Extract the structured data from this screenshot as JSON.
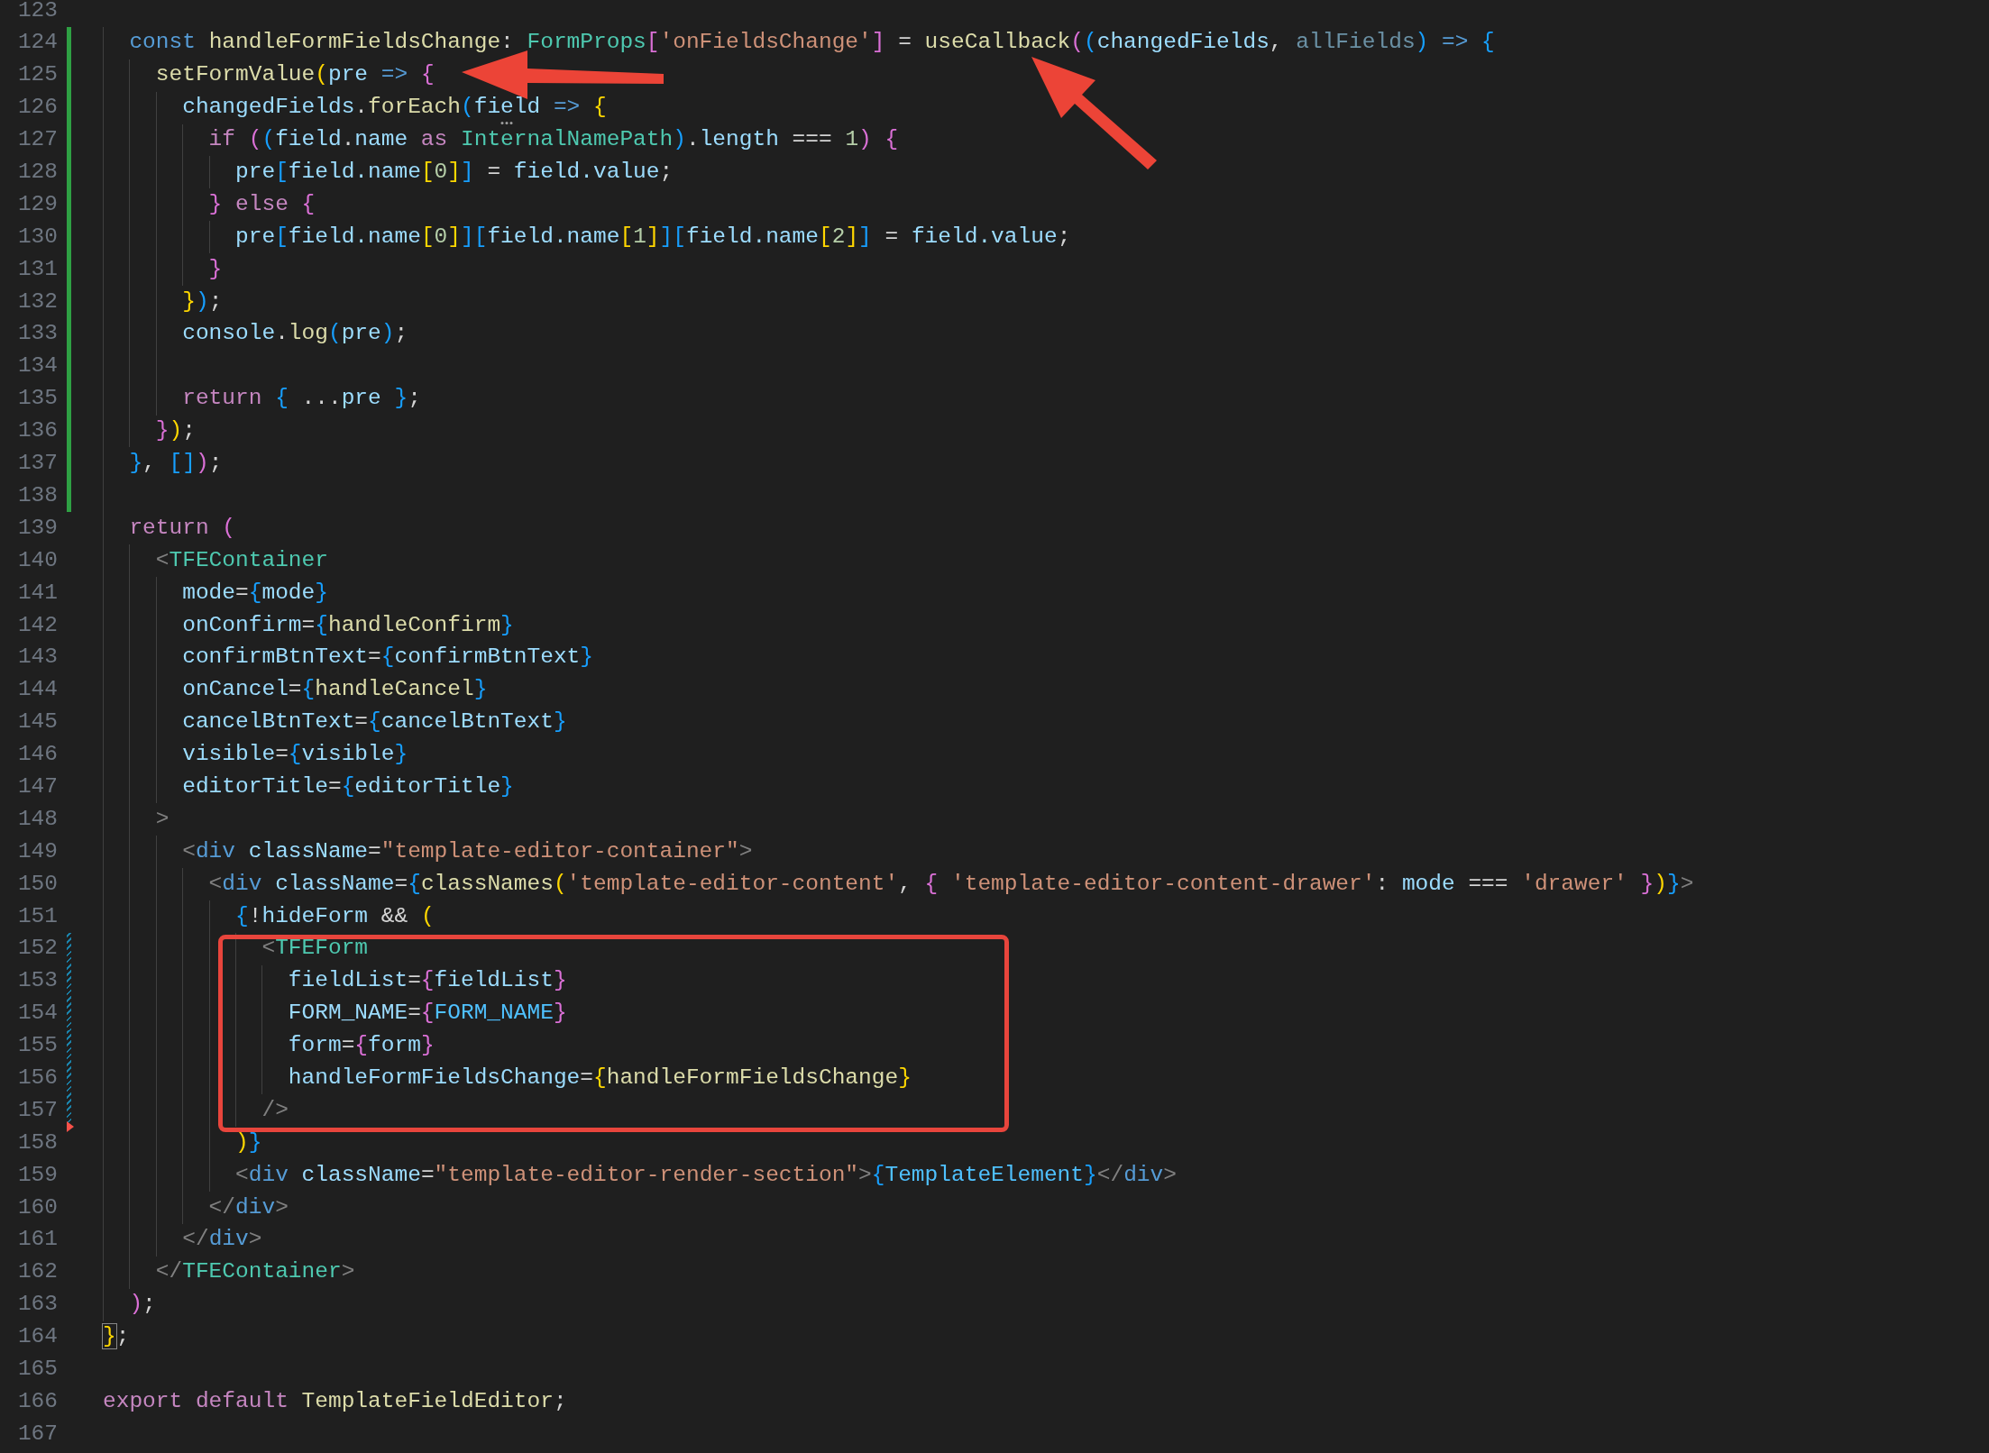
{
  "editor": {
    "lines": [
      {
        "number": "123",
        "kind": "plain"
      },
      {
        "number": "124",
        "kind": "added",
        "tokens": [
          {
            "text": "  const ",
            "kind": "kw"
          },
          {
            "text": "handleFormFieldsChange",
            "kind": "fn"
          },
          {
            "text": ": ",
            "kind": "p"
          },
          {
            "text": "FormProps",
            "kind": "type"
          },
          {
            "text": "[",
            "kind": "b2"
          },
          {
            "text": "'onFieldsChange'",
            "kind": "str"
          },
          {
            "text": "]",
            "kind": "b2"
          },
          {
            "text": " = ",
            "kind": "p"
          },
          {
            "text": "useCallback",
            "kind": "fn"
          },
          {
            "text": "(",
            "kind": "b2"
          },
          {
            "text": "(",
            "kind": "b3"
          },
          {
            "text": "changedFields",
            "kind": "var"
          },
          {
            "text": ", ",
            "kind": "p"
          },
          {
            "text": "allFields",
            "kind": "unused"
          },
          {
            "text": ")",
            "kind": "b3"
          },
          {
            "text": " => ",
            "kind": "kw"
          },
          {
            "text": "{",
            "kind": "b3"
          }
        ]
      },
      {
        "number": "125",
        "kind": "added",
        "tokens": [
          {
            "text": "    setFormValue",
            "kind": "fn"
          },
          {
            "text": "(",
            "kind": "b1"
          },
          {
            "text": "pre",
            "kind": "var"
          },
          {
            "text": " => ",
            "kind": "kw"
          },
          {
            "text": "{",
            "kind": "b2"
          }
        ]
      },
      {
        "number": "126",
        "kind": "added",
        "tokens": [
          {
            "text": "      changedFields",
            "kind": "var"
          },
          {
            "text": ".",
            "kind": "p"
          },
          {
            "text": "forEach",
            "kind": "fn"
          },
          {
            "text": "(",
            "kind": "b3"
          },
          {
            "text": "field",
            "kind": "var",
            "hint": true
          },
          {
            "text": " => ",
            "kind": "kw"
          },
          {
            "text": "{",
            "kind": "b1"
          }
        ]
      },
      {
        "number": "127",
        "kind": "added",
        "tokens": [
          {
            "text": "        if ",
            "kind": "ctrl"
          },
          {
            "text": "(",
            "kind": "b2"
          },
          {
            "text": "(",
            "kind": "b3"
          },
          {
            "text": "field",
            "kind": "var"
          },
          {
            "text": ".",
            "kind": "p"
          },
          {
            "text": "name",
            "kind": "var"
          },
          {
            "text": " as ",
            "kind": "ctrl"
          },
          {
            "text": "InternalNamePath",
            "kind": "type"
          },
          {
            "text": ")",
            "kind": "b3"
          },
          {
            "text": ".",
            "kind": "p"
          },
          {
            "text": "length",
            "kind": "var"
          },
          {
            "text": " === ",
            "kind": "p"
          },
          {
            "text": "1",
            "kind": "num"
          },
          {
            "text": ") {",
            "kind": "b2"
          }
        ]
      },
      {
        "number": "128",
        "kind": "added",
        "tokens": [
          {
            "text": "          pre",
            "kind": "var"
          },
          {
            "text": "[",
            "kind": "b3"
          },
          {
            "text": "field.name",
            "kind": "var"
          },
          {
            "text": "[",
            "kind": "b1"
          },
          {
            "text": "0",
            "kind": "num"
          },
          {
            "text": "]",
            "kind": "b1"
          },
          {
            "text": "]",
            "kind": "b3"
          },
          {
            "text": " = ",
            "kind": "p"
          },
          {
            "text": "field.value",
            "kind": "var"
          },
          {
            "text": ";",
            "kind": "p"
          }
        ]
      },
      {
        "number": "129",
        "kind": "added",
        "tokens": [
          {
            "text": "        }",
            "kind": "b2"
          },
          {
            "text": " else ",
            "kind": "ctrl"
          },
          {
            "text": "{",
            "kind": "b2"
          }
        ]
      },
      {
        "number": "130",
        "kind": "added",
        "tokens": [
          {
            "text": "          pre",
            "kind": "var"
          },
          {
            "text": "[",
            "kind": "b3"
          },
          {
            "text": "field.name",
            "kind": "var"
          },
          {
            "text": "[",
            "kind": "b1"
          },
          {
            "text": "0",
            "kind": "num"
          },
          {
            "text": "]",
            "kind": "b1"
          },
          {
            "text": "]",
            "kind": "b3"
          },
          {
            "text": "[",
            "kind": "b3"
          },
          {
            "text": "field.name",
            "kind": "var"
          },
          {
            "text": "[",
            "kind": "b1"
          },
          {
            "text": "1",
            "kind": "num"
          },
          {
            "text": "]",
            "kind": "b1"
          },
          {
            "text": "]",
            "kind": "b3"
          },
          {
            "text": "[",
            "kind": "b3"
          },
          {
            "text": "field.name",
            "kind": "var"
          },
          {
            "text": "[",
            "kind": "b1"
          },
          {
            "text": "2",
            "kind": "num"
          },
          {
            "text": "]",
            "kind": "b1"
          },
          {
            "text": "]",
            "kind": "b3"
          },
          {
            "text": " = ",
            "kind": "p"
          },
          {
            "text": "field.value",
            "kind": "var"
          },
          {
            "text": ";",
            "kind": "p"
          }
        ]
      },
      {
        "number": "131",
        "kind": "added",
        "tokens": [
          {
            "text": "        }",
            "kind": "b2"
          }
        ]
      },
      {
        "number": "132",
        "kind": "added",
        "tokens": [
          {
            "text": "      }",
            "kind": "b1"
          },
          {
            "text": ")",
            "kind": "b3"
          },
          {
            "text": ";",
            "kind": "p"
          }
        ]
      },
      {
        "number": "133",
        "kind": "added",
        "tokens": [
          {
            "text": "      console",
            "kind": "var"
          },
          {
            "text": ".",
            "kind": "p"
          },
          {
            "text": "log",
            "kind": "fn"
          },
          {
            "text": "(",
            "kind": "b3"
          },
          {
            "text": "pre",
            "kind": "var"
          },
          {
            "text": ")",
            "kind": "b3"
          },
          {
            "text": ";",
            "kind": "p"
          }
        ]
      },
      {
        "number": "134",
        "kind": "added"
      },
      {
        "number": "135",
        "kind": "added",
        "tokens": [
          {
            "text": "      return ",
            "kind": "ctrl"
          },
          {
            "text": "{",
            "kind": "b3"
          },
          {
            "text": " ...",
            "kind": "p"
          },
          {
            "text": "pre",
            "kind": "var"
          },
          {
            "text": " }",
            "kind": "b3"
          },
          {
            "text": ";",
            "kind": "p"
          }
        ]
      },
      {
        "number": "136",
        "kind": "added",
        "tokens": [
          {
            "text": "    }",
            "kind": "b2"
          },
          {
            "text": ")",
            "kind": "b1"
          },
          {
            "text": ";",
            "kind": "p"
          }
        ]
      },
      {
        "number": "137",
        "kind": "added",
        "tokens": [
          {
            "text": "  }",
            "kind": "b3"
          },
          {
            "text": ", ",
            "kind": "p"
          },
          {
            "text": "[",
            "kind": "b3"
          },
          {
            "text": "]",
            "kind": "b3"
          },
          {
            "text": ")",
            "kind": "b2"
          },
          {
            "text": ";",
            "kind": "p"
          }
        ]
      },
      {
        "number": "138",
        "kind": "added"
      },
      {
        "number": "139",
        "kind": "plain",
        "tokens": [
          {
            "text": "  return ",
            "kind": "ctrl"
          },
          {
            "text": "(",
            "kind": "b2"
          }
        ]
      },
      {
        "number": "140",
        "kind": "plain",
        "tokens": [
          {
            "text": "    <",
            "kind": "tag"
          },
          {
            "text": "TFEContainer",
            "kind": "type"
          }
        ]
      },
      {
        "number": "141",
        "kind": "plain",
        "tokens": [
          {
            "text": "      mode",
            "kind": "attr"
          },
          {
            "text": "=",
            "kind": "p"
          },
          {
            "text": "{",
            "kind": "b3"
          },
          {
            "text": "mode",
            "kind": "var"
          },
          {
            "text": "}",
            "kind": "b3"
          }
        ]
      },
      {
        "number": "142",
        "kind": "plain",
        "tokens": [
          {
            "text": "      onConfirm",
            "kind": "attr"
          },
          {
            "text": "=",
            "kind": "p"
          },
          {
            "text": "{",
            "kind": "b3"
          },
          {
            "text": "handleConfirm",
            "kind": "fn"
          },
          {
            "text": "}",
            "kind": "b3"
          }
        ]
      },
      {
        "number": "143",
        "kind": "plain",
        "tokens": [
          {
            "text": "      confirmBtnText",
            "kind": "attr"
          },
          {
            "text": "=",
            "kind": "p"
          },
          {
            "text": "{",
            "kind": "b3"
          },
          {
            "text": "confirmBtnText",
            "kind": "var"
          },
          {
            "text": "}",
            "kind": "b3"
          }
        ]
      },
      {
        "number": "144",
        "kind": "plain",
        "tokens": [
          {
            "text": "      onCancel",
            "kind": "attr"
          },
          {
            "text": "=",
            "kind": "p"
          },
          {
            "text": "{",
            "kind": "b3"
          },
          {
            "text": "handleCancel",
            "kind": "fn"
          },
          {
            "text": "}",
            "kind": "b3"
          }
        ]
      },
      {
        "number": "145",
        "kind": "plain",
        "tokens": [
          {
            "text": "      cancelBtnText",
            "kind": "attr"
          },
          {
            "text": "=",
            "kind": "p"
          },
          {
            "text": "{",
            "kind": "b3"
          },
          {
            "text": "cancelBtnText",
            "kind": "var"
          },
          {
            "text": "}",
            "kind": "b3"
          }
        ]
      },
      {
        "number": "146",
        "kind": "plain",
        "tokens": [
          {
            "text": "      visible",
            "kind": "attr"
          },
          {
            "text": "=",
            "kind": "p"
          },
          {
            "text": "{",
            "kind": "b3"
          },
          {
            "text": "visible",
            "kind": "var"
          },
          {
            "text": "}",
            "kind": "b3"
          }
        ]
      },
      {
        "number": "147",
        "kind": "plain",
        "tokens": [
          {
            "text": "      editorTitle",
            "kind": "attr"
          },
          {
            "text": "=",
            "kind": "p"
          },
          {
            "text": "{",
            "kind": "b3"
          },
          {
            "text": "editorTitle",
            "kind": "var"
          },
          {
            "text": "}",
            "kind": "b3"
          }
        ]
      },
      {
        "number": "148",
        "kind": "plain",
        "tokens": [
          {
            "text": "    >",
            "kind": "tag"
          }
        ]
      },
      {
        "number": "149",
        "kind": "plain",
        "tokens": [
          {
            "text": "      <",
            "kind": "tag"
          },
          {
            "text": "div ",
            "kind": "kw"
          },
          {
            "text": "className",
            "kind": "attr"
          },
          {
            "text": "=",
            "kind": "p"
          },
          {
            "text": "\"template-editor-container\"",
            "kind": "str"
          },
          {
            "text": ">",
            "kind": "tag"
          }
        ]
      },
      {
        "number": "150",
        "kind": "plain",
        "tokens": [
          {
            "text": "        <",
            "kind": "tag"
          },
          {
            "text": "div ",
            "kind": "kw"
          },
          {
            "text": "className",
            "kind": "attr"
          },
          {
            "text": "=",
            "kind": "p"
          },
          {
            "text": "{",
            "kind": "b3"
          },
          {
            "text": "classNames",
            "kind": "fn"
          },
          {
            "text": "(",
            "kind": "b1"
          },
          {
            "text": "'template-editor-content'",
            "kind": "str"
          },
          {
            "text": ", ",
            "kind": "p"
          },
          {
            "text": "{ ",
            "kind": "b2"
          },
          {
            "text": "'template-editor-content-drawer'",
            "kind": "str"
          },
          {
            "text": ": ",
            "kind": "p"
          },
          {
            "text": "mode",
            "kind": "var"
          },
          {
            "text": " === ",
            "kind": "p"
          },
          {
            "text": "'drawer'",
            "kind": "str"
          },
          {
            "text": " }",
            "kind": "b2"
          },
          {
            "text": ")",
            "kind": "b1"
          },
          {
            "text": "}",
            "kind": "b3"
          },
          {
            "text": ">",
            "kind": "tag"
          }
        ]
      },
      {
        "number": "151",
        "kind": "plain",
        "tokens": [
          {
            "text": "          {",
            "kind": "b3"
          },
          {
            "text": "!",
            "kind": "p"
          },
          {
            "text": "hideForm",
            "kind": "var"
          },
          {
            "text": " && ",
            "kind": "p"
          },
          {
            "text": "(",
            "kind": "b1"
          }
        ]
      },
      {
        "number": "152",
        "kind": "modified",
        "tokens": [
          {
            "text": "            <",
            "kind": "tag"
          },
          {
            "text": "TFEForm",
            "kind": "type"
          }
        ]
      },
      {
        "number": "153",
        "kind": "modified",
        "tokens": [
          {
            "text": "              fieldList",
            "kind": "attr"
          },
          {
            "text": "=",
            "kind": "p"
          },
          {
            "text": "{",
            "kind": "b2"
          },
          {
            "text": "fieldList",
            "kind": "var"
          },
          {
            "text": "}",
            "kind": "b2"
          }
        ]
      },
      {
        "number": "154",
        "kind": "modified",
        "tokens": [
          {
            "text": "              FORM_NAME",
            "kind": "attr"
          },
          {
            "text": "=",
            "kind": "p"
          },
          {
            "text": "{",
            "kind": "b2"
          },
          {
            "text": "FORM_NAME",
            "kind": "const"
          },
          {
            "text": "}",
            "kind": "b2"
          }
        ]
      },
      {
        "number": "155",
        "kind": "modified",
        "tokens": [
          {
            "text": "              form",
            "kind": "attr"
          },
          {
            "text": "=",
            "kind": "p"
          },
          {
            "text": "{",
            "kind": "b2"
          },
          {
            "text": "form",
            "kind": "var"
          },
          {
            "text": "}",
            "kind": "b2"
          }
        ]
      },
      {
        "number": "156",
        "kind": "modified",
        "tokens": [
          {
            "text": "              handleFormFieldsChange",
            "kind": "attr"
          },
          {
            "text": "=",
            "kind": "p"
          },
          {
            "text": "{",
            "kind": "b1"
          },
          {
            "text": "handleFormFieldsChange",
            "kind": "fn"
          },
          {
            "text": "}",
            "kind": "b1"
          }
        ]
      },
      {
        "number": "157",
        "kind": "modified",
        "tokens": [
          {
            "text": "            />",
            "kind": "tag"
          }
        ]
      },
      {
        "number": "158",
        "kind": "deleted",
        "tokens": [
          {
            "text": "          )",
            "kind": "b1"
          },
          {
            "text": "}",
            "kind": "b3"
          }
        ]
      },
      {
        "number": "159",
        "kind": "plain",
        "tokens": [
          {
            "text": "          <",
            "kind": "tag"
          },
          {
            "text": "div ",
            "kind": "kw"
          },
          {
            "text": "className",
            "kind": "attr"
          },
          {
            "text": "=",
            "kind": "p"
          },
          {
            "text": "\"template-editor-render-section\"",
            "kind": "str"
          },
          {
            "text": ">",
            "kind": "tag"
          },
          {
            "text": "{",
            "kind": "b3"
          },
          {
            "text": "TemplateElement",
            "kind": "const"
          },
          {
            "text": "}",
            "kind": "b3"
          },
          {
            "text": "</",
            "kind": "tag"
          },
          {
            "text": "div",
            "kind": "kw"
          },
          {
            "text": ">",
            "kind": "tag"
          }
        ]
      },
      {
        "number": "160",
        "kind": "plain",
        "tokens": [
          {
            "text": "        </",
            "kind": "tag"
          },
          {
            "text": "div",
            "kind": "kw"
          },
          {
            "text": ">",
            "kind": "tag"
          }
        ]
      },
      {
        "number": "161",
        "kind": "plain",
        "tokens": [
          {
            "text": "      </",
            "kind": "tag"
          },
          {
            "text": "div",
            "kind": "kw"
          },
          {
            "text": ">",
            "kind": "tag"
          }
        ]
      },
      {
        "number": "162",
        "kind": "plain",
        "tokens": [
          {
            "text": "    </",
            "kind": "tag"
          },
          {
            "text": "TFEContainer",
            "kind": "type"
          },
          {
            "text": ">",
            "kind": "tag"
          }
        ]
      },
      {
        "number": "163",
        "kind": "plain",
        "tokens": [
          {
            "text": "  )",
            "kind": "b2"
          },
          {
            "text": ";",
            "kind": "p"
          }
        ]
      },
      {
        "number": "164",
        "kind": "plain",
        "tokens": [
          {
            "text": "}",
            "kind": "b1",
            "bracket_match": true
          },
          {
            "text": ";",
            "kind": "p"
          }
        ]
      },
      {
        "number": "165",
        "kind": "plain"
      },
      {
        "number": "166",
        "kind": "plain",
        "tokens": [
          {
            "text": "export default ",
            "kind": "ctrl"
          },
          {
            "text": "TemplateFieldEditor",
            "kind": "fn"
          },
          {
            "text": ";",
            "kind": "p"
          }
        ]
      },
      {
        "number": "167",
        "kind": "plain"
      }
    ]
  }
}
